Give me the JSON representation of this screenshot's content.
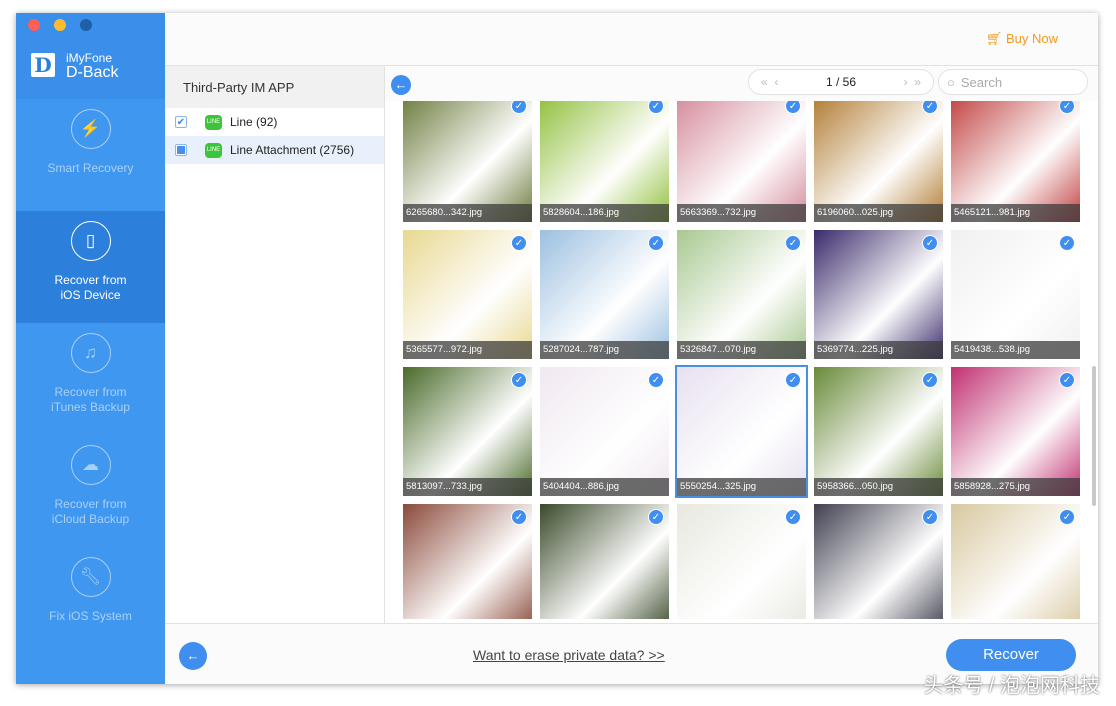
{
  "app": {
    "brand_small": "iMyFone",
    "brand_large": "D-Back",
    "logo_letter": "D"
  },
  "sidebar": {
    "items": [
      {
        "label": "Smart Recovery",
        "icon": "lightning-refresh-icon",
        "selected": false
      },
      {
        "label": "Recover from iOS Device",
        "icon": "phone-refresh-icon",
        "selected": true
      },
      {
        "label": "Recover from iTunes Backup",
        "icon": "music-note-icon",
        "selected": false
      },
      {
        "label": "Recover from iCloud Backup",
        "icon": "cloud-download-icon",
        "selected": false
      },
      {
        "label": "Fix iOS System",
        "icon": "wrench-icon",
        "selected": false
      }
    ]
  },
  "header": {
    "buy_now": "Buy Now"
  },
  "left_panel": {
    "title": "Third-Party IM APP",
    "items": [
      {
        "label": "Line (92)",
        "checked": "full"
      },
      {
        "label": "Line Attachment (2756)",
        "checked": "partial"
      }
    ]
  },
  "toolbar": {
    "page": "1 / 56",
    "search_placeholder": "Search"
  },
  "tiles": [
    {
      "file": "6265680...342.jpg",
      "color": "#6a7a3a"
    },
    {
      "file": "5828604...186.jpg",
      "color": "#8fbf3a"
    },
    {
      "file": "5663369...732.jpg",
      "color": "#d48a9a"
    },
    {
      "file": "6196060...025.jpg",
      "color": "#b07a30"
    },
    {
      "file": "5465121...981.jpg",
      "color": "#c04040"
    },
    {
      "file": "5365577...972.jpg",
      "color": "#e8d890"
    },
    {
      "file": "5287024...787.jpg",
      "color": "#9cc0e0"
    },
    {
      "file": "5326847...070.jpg",
      "color": "#a8c890"
    },
    {
      "file": "5369774...225.jpg",
      "color": "#3a2a6a"
    },
    {
      "file": "5419438...538.jpg",
      "color": "#f0f0f0"
    },
    {
      "file": "5813097...733.jpg",
      "color": "#4a6a2a"
    },
    {
      "file": "5404404...886.jpg",
      "color": "#f0e8f0"
    },
    {
      "file": "5550254...325.jpg",
      "color": "#e8e0f0"
    },
    {
      "file": "5958366...050.jpg",
      "color": "#6a8a3a"
    },
    {
      "file": "5858928...275.jpg",
      "color": "#c03070"
    },
    {
      "file": "",
      "color": "#8a4a3a"
    },
    {
      "file": "",
      "color": "#3a4a2a"
    },
    {
      "file": "",
      "color": "#e8e8e0"
    },
    {
      "file": "",
      "color": "#404050"
    },
    {
      "file": "",
      "color": "#d8c8a0"
    }
  ],
  "footer": {
    "erase_link": "Want to erase private data? >>",
    "recover": "Recover"
  },
  "watermark": "头条号 / 泡泡网科技"
}
